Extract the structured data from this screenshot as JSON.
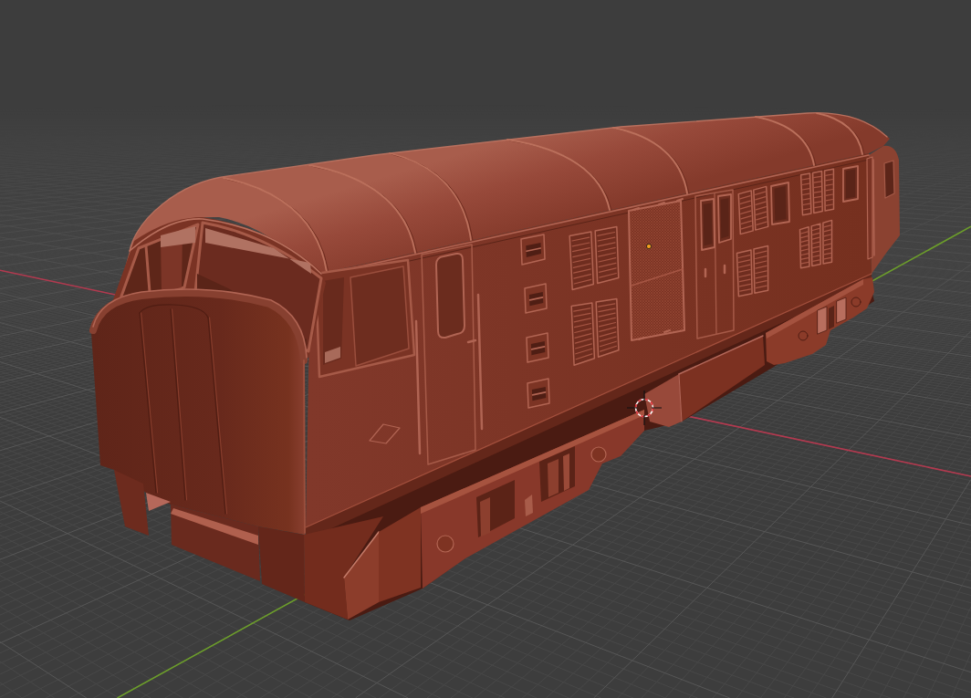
{
  "viewport": {
    "grid": true,
    "axes": [
      {
        "color": "#b3394f"
      },
      {
        "color": "#6c9e2a"
      }
    ],
    "cursor_3d": true
  },
  "objects": [
    {
      "kind": "locomotive",
      "origin": true
    }
  ]
}
